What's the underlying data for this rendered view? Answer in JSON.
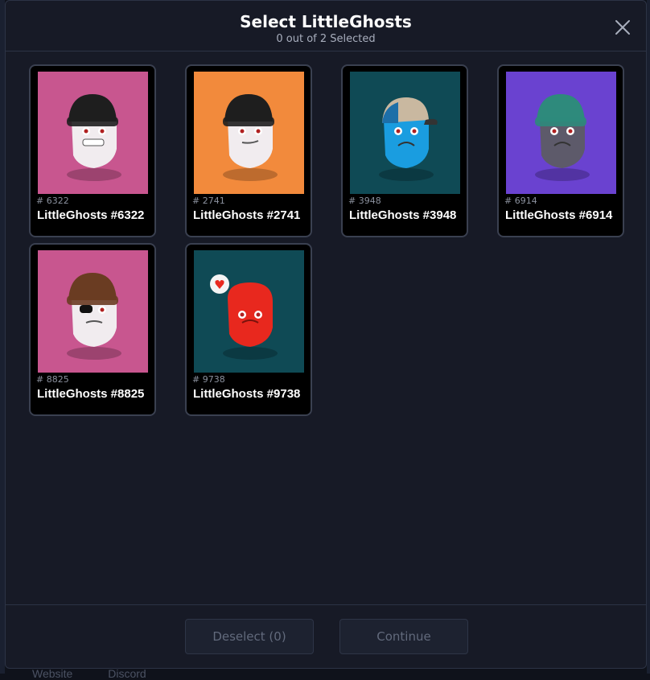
{
  "background_footer": {
    "website": "Website",
    "discord": "Discord"
  },
  "modal": {
    "title": "Select LittleGhosts",
    "subtitle": "0 out of 2 Selected"
  },
  "items": [
    {
      "id": "# 6322",
      "name": "LittleGhosts #6322",
      "bg": "#c8568f",
      "hat": "beanie-black",
      "body": "white",
      "mouth": "grin"
    },
    {
      "id": "# 2741",
      "name": "LittleGhosts #2741",
      "bg": "#f28a3c",
      "hat": "beanie-black",
      "body": "white",
      "mouth": "smirk"
    },
    {
      "id": "# 3948",
      "name": "LittleGhosts #3948",
      "bg": "#0f4a55",
      "hat": "cap-beige",
      "body": "blue",
      "mouth": "frown"
    },
    {
      "id": "# 6914",
      "name": "LittleGhosts #6914",
      "bg": "#6a42d0",
      "hat": "beanie-green",
      "body": "gray",
      "mouth": "frown"
    },
    {
      "id": "# 8825",
      "name": "LittleGhosts #8825",
      "bg": "#c8568f",
      "hat": "beanie-brown",
      "body": "white",
      "mouth": "eyepatch"
    },
    {
      "id": "# 9738",
      "name": "LittleGhosts #9738",
      "bg": "#0f4a55",
      "hat": "none",
      "body": "red",
      "mouth": "heart-bubble"
    }
  ],
  "footer": {
    "deselect_label": "Deselect (0)",
    "continue_label": "Continue"
  },
  "icons": {
    "close": "close-icon"
  }
}
